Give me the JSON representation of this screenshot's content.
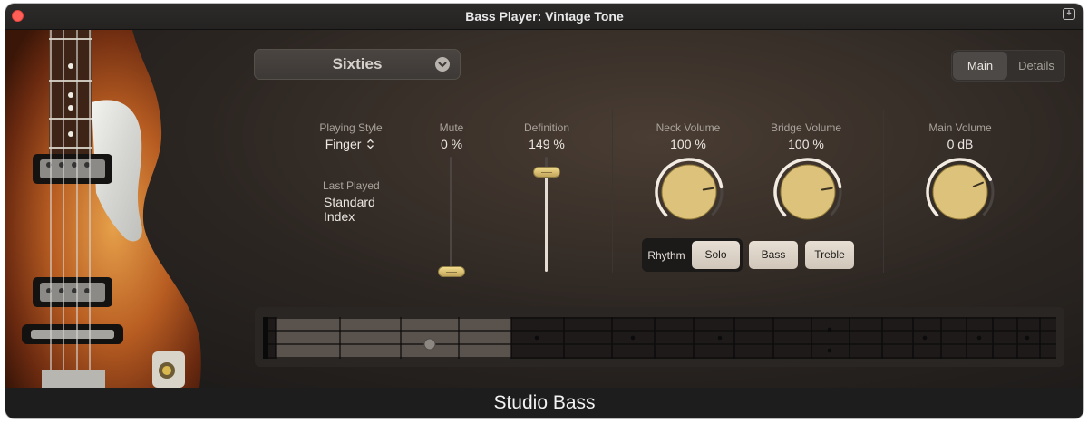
{
  "window": {
    "title": "Bass Player: Vintage Tone",
    "footer_title": "Studio Bass"
  },
  "preset": {
    "name": "Sixties"
  },
  "view_tabs": {
    "main": "Main",
    "details": "Details",
    "selected": "Main"
  },
  "playing_style": {
    "label": "Playing Style",
    "value": "Finger"
  },
  "last_played": {
    "label": "Last Played",
    "value_line1": "Standard",
    "value_line2": "Index"
  },
  "mute": {
    "label": "Mute",
    "value": "0 %",
    "level": 0
  },
  "definition": {
    "label": "Definition",
    "value": "149 %",
    "level": 0.87
  },
  "neck_volume": {
    "label": "Neck Volume",
    "value": "100 %",
    "level": 0.8
  },
  "bridge_volume": {
    "label": "Bridge Volume",
    "value": "100 %",
    "level": 0.8
  },
  "main_volume": {
    "label": "Main Volume",
    "value": "0 dB",
    "level": 0.75
  },
  "buttons": {
    "rhythm": "Rhythm",
    "solo": "Solo",
    "bass": "Bass",
    "treble": "Treble"
  },
  "icons": {
    "close": "close-icon",
    "save": "save-icon",
    "dropdown": "chevron-down-icon",
    "stepper": "up-down-chevron-icon"
  },
  "colors": {
    "accent_gold": "#dcc27a",
    "close_red": "#ff5f57",
    "background": "#2c2622"
  }
}
